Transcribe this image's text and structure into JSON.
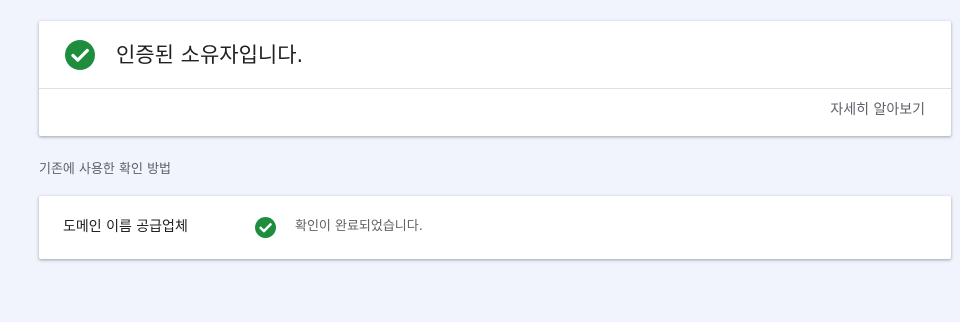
{
  "verified_card": {
    "title": "인증된 소유자입니다.",
    "learn_more": "자세히 알아보기",
    "icon": "check-circle-icon"
  },
  "previous_methods": {
    "heading": "기존에 사용한 확인 방법",
    "items": [
      {
        "method": "도메인 이름 공급업체",
        "status": "확인이 완료되었습니다.",
        "icon": "check-circle-icon"
      }
    ]
  },
  "colors": {
    "background": "#f1f4fc",
    "success": "#1e8e3e",
    "primary_text": "#202124",
    "secondary_text": "#5f6368",
    "divider": "#e0e0e0"
  }
}
